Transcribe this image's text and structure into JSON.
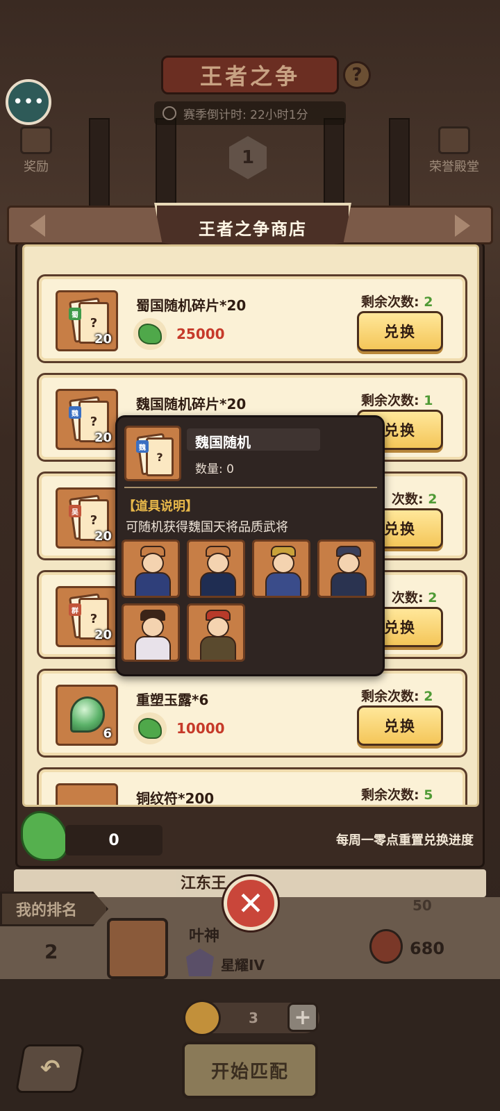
{
  "background": {
    "title": "王者之争",
    "help_label": "?",
    "countdown": "赛季倒计时: 22小时1分",
    "rank_badge": "1",
    "left_button_label": "奖励",
    "right_button_label": "荣誉殿堂"
  },
  "shop": {
    "title": "王者之争商店",
    "items": [
      {
        "name": "蜀国随机碎片*20",
        "faction": "蜀",
        "faction_color": "#3f9a4a",
        "qty": "20",
        "price": "25000",
        "remain_label": "剩余次数:",
        "remain": "2",
        "button": "兑换"
      },
      {
        "name": "魏国随机碎片*20",
        "faction": "魏",
        "faction_color": "#3a6fc2",
        "qty": "20",
        "price": "",
        "remain_label": "剩余次数:",
        "remain": "1",
        "button": "兑换"
      },
      {
        "name": "",
        "faction": "吴",
        "faction_color": "#c2553a",
        "qty": "20",
        "price": "",
        "remain_label": "次数:",
        "remain": "2",
        "button": "兑换"
      },
      {
        "name": "",
        "faction": "群",
        "faction_color": "#c2553a",
        "qty": "20",
        "price": "",
        "remain_label": "次数:",
        "remain": "2",
        "button": "兑换"
      },
      {
        "name": "重塑玉露*6",
        "qty": "6",
        "price": "10000",
        "remain_label": "剩余次数:",
        "remain": "2",
        "button": "兑换"
      },
      {
        "name": "铜纹符*200",
        "remain_label": "剩余次数:",
        "remain": "5"
      }
    ],
    "coin_balance": "0",
    "reset_note": "每周一零点重置兑换进度"
  },
  "tooltip": {
    "name": "魏国随机",
    "faction": "魏",
    "quantity": "数量: 0",
    "desc_title": "【道具说明】",
    "desc": "可随机获得魏国天将品质武将",
    "heroes": [
      {
        "icon": "hero-portrait-1",
        "color": "#2f3f7a"
      },
      {
        "icon": "hero-portrait-2",
        "color": "#1f2d52"
      },
      {
        "icon": "hero-portrait-3",
        "color": "#3a4c8a"
      },
      {
        "icon": "hero-portrait-4",
        "color": "#2a3350"
      },
      {
        "icon": "hero-portrait-5",
        "color": "#e8e2ea"
      },
      {
        "icon": "hero-portrait-6",
        "color": "#5a4a2e"
      }
    ]
  },
  "ranking": {
    "peek_name": "江东王",
    "peek_points": "50",
    "my_rank_label": "我的排名",
    "my_rank": "2",
    "my_name": "叶神",
    "my_tier": "星耀IV",
    "my_points": "680"
  },
  "bottom": {
    "tickets": "3",
    "add_label": "+",
    "match_label": "开始匹配",
    "back_label": "↶"
  },
  "close_label": "✕"
}
